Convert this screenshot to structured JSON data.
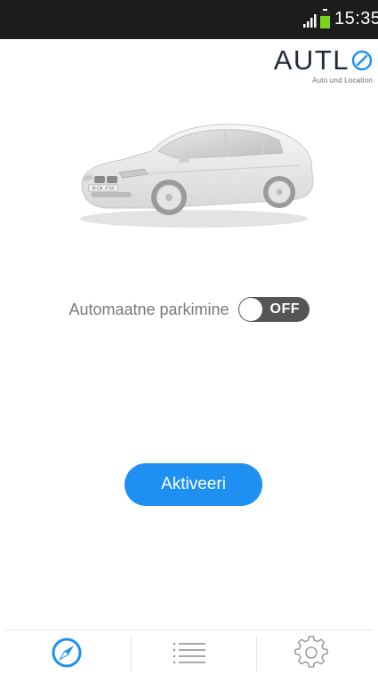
{
  "status_bar": {
    "time": "15:35",
    "icons": [
      "signal-icon",
      "battery-icon"
    ]
  },
  "logo": {
    "word_prefix": "AUTL",
    "word_last_letter": "O",
    "tagline": "Auto und Location"
  },
  "car": {
    "plate": "M-DK 4760",
    "icon": "car-image"
  },
  "parking": {
    "label": "Automaatne parkimine",
    "toggle_state": "OFF"
  },
  "activate": {
    "label": "Aktiveeri"
  },
  "colors": {
    "accent": "#1e90f2",
    "status_bar": "#1c1c1c",
    "toggle_off": "#555555",
    "battery": "#7ed321",
    "logo_text": "#1f2a3a"
  },
  "bottom_nav": {
    "items": [
      {
        "icon": "compass-icon",
        "active": true
      },
      {
        "icon": "list-icon",
        "active": false
      },
      {
        "icon": "settings-gear-icon",
        "active": false
      }
    ]
  }
}
